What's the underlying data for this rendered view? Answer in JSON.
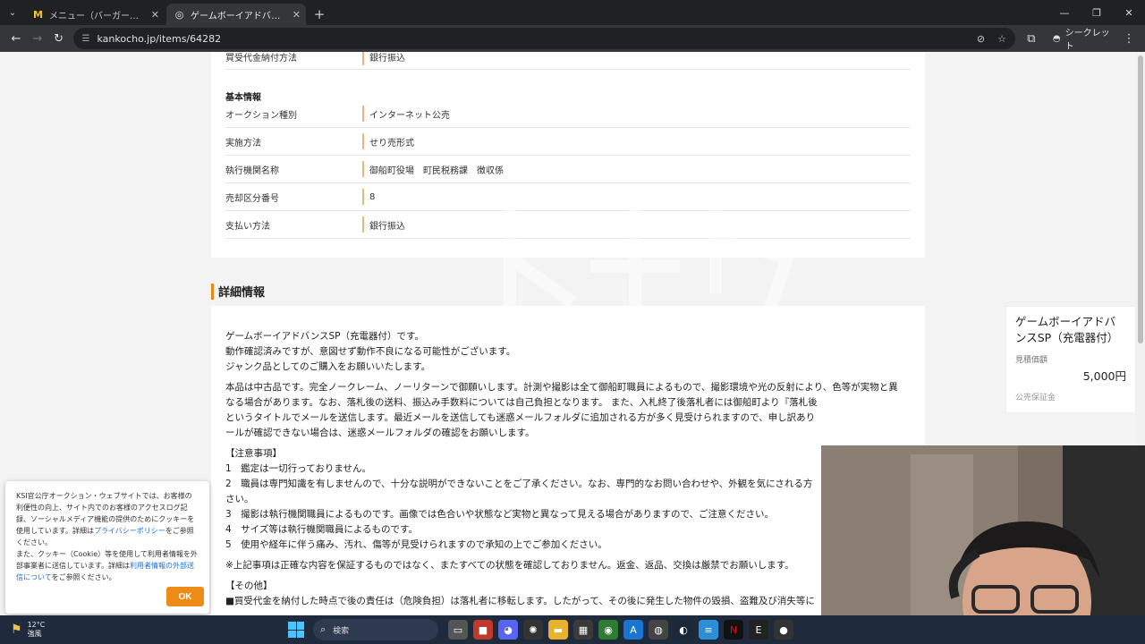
{
  "browser": {
    "tabs": [
      {
        "title": "メニュー（バーガー）| マクドナルド公",
        "icon": "mcdonalds-icon",
        "active": false
      },
      {
        "title": "ゲームボーイアドバンスSP（充電器付",
        "icon": "globe-icon",
        "active": true
      }
    ],
    "url": "kankocho.jp/items/64282",
    "incognito_label": "シークレット"
  },
  "basic_top_row": {
    "label": "買受代金納付方法",
    "value": "銀行振込"
  },
  "basic_info": {
    "heading": "基本情報",
    "rows": [
      {
        "label": "オークション種別",
        "value": "インターネット公売"
      },
      {
        "label": "実施方法",
        "value": "せり売形式"
      },
      {
        "label": "執行機関名称",
        "value": "御船町役場　町民税務課　徴収係"
      },
      {
        "label": "売却区分番号",
        "value": "8"
      },
      {
        "label": "支払い方法",
        "value": "銀行振込"
      }
    ]
  },
  "details": {
    "heading": "詳細情報",
    "lines": [
      "ゲームボーイアドバンスSP（充電器付）です。",
      "動作確認済みですが、意図せず動作不良になる可能性がございます。",
      "ジャンク品としてのご購入をお願いいたします。",
      "",
      "本品は中古品です。完全ノークレーム、ノーリターンで御願いします。計測や撮影は全て御船町職員によるもので、撮影環境や光の反射により、色等が実物と異",
      "なる場合があります。なお、落札後の送料、振込み手数料については自己負担となります。 また、入札終了後落札者には御船町より『落札後",
      "というタイトルでメールを送信します。最近メールを送信しても迷惑メールフォルダに追加される方が多く見受けられますので、申し訳あり",
      "ールが確認できない場合は、迷惑メールフォルダの確認をお願いします。",
      "",
      "【注意事項】",
      "1　鑑定は一切行っておりません。",
      "2　職員は専門知識を有しませんので、十分な説明ができないことをご了承ください。なお、専門的なお問い合わせや、外観を気にされる方",
      "さい。",
      "3　撮影は執行機関職員によるものです。画像では色合いや状態など実物と異なって見える場合がありますので、ご注意ください。",
      "4　サイズ等は執行機関職員によるものです。",
      "5　使用や経年に伴う痛み、汚れ、傷等が見受けられますので承知の上でご参加ください。",
      "",
      "※上記事項は正確な内容を保証するものではなく、またすべての状態を確認しておりません。返金、返品、交換は厳禁でお願いします。",
      "",
      "【その他】",
      "■買受代金を納付した時点で後の責任は（危険負担）は落札者に移転します。したがって、その後に発生した物件の毀損、盗難及び消失等に"
    ]
  },
  "side_card": {
    "title": "ゲームボーイアドバンスSP（充電器付）",
    "estimate_label": "見積価額",
    "estimate_value": "5,000円",
    "next_label": "公売保証金"
  },
  "cookie": {
    "text1": "KSI官公庁オークション・ウェブサイトでは、お客様の利便性の向上、サイト内でのお客様のアクセスログ記録、ソーシャルメディア機能の提供のためにクッキーを使用しています。詳細は",
    "link1": "プライバシーポリシー",
    "text2": "をご参照ください。",
    "text3": "また、クッキー（Cookie）等を使用して利用者情報を外部事業者に送信しています。詳細は",
    "link2": "利用者情報の外部送信について",
    "text4": "をご参照ください。",
    "ok": "OK"
  },
  "taskbar": {
    "temp": "12°C",
    "wind": "強風",
    "search": "検索"
  },
  "colors": {
    "accent": "#e88a1a",
    "label_border": "#e8b87a",
    "ok_button": "#ee8a16",
    "link": "#1a6fd6"
  }
}
